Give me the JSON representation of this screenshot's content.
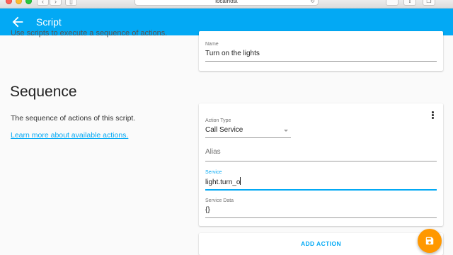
{
  "browser": {
    "url": "localhost",
    "back_glyph": "‹",
    "forward_glyph": "›",
    "reload_glyph": "↻",
    "share_glyph": "⇪",
    "newtab_glyph": "+",
    "tabs_glyph": "❐",
    "sidebar_glyph": "▯"
  },
  "appbar": {
    "title": "Script",
    "color": "#03a9f4"
  },
  "intro": {
    "description": "Use scripts to execute a sequence of actions."
  },
  "name_card": {
    "label": "Name",
    "value": "Turn on the lights"
  },
  "sequence": {
    "title": "Sequence",
    "description": "The sequence of actions of this script.",
    "link_label": "Learn more about available actions."
  },
  "action_card": {
    "action_type": {
      "label": "Action Type",
      "value": "Call Service"
    },
    "alias": {
      "placeholder": "Alias"
    },
    "service": {
      "label": "Service",
      "value": "light.turn_o"
    },
    "service_data": {
      "label": "Service Data",
      "value": "{}"
    },
    "menu_icon": "more-vert-icon"
  },
  "add_action": {
    "label": "ADD ACTION"
  },
  "fab": {
    "icon": "save-icon",
    "color": "#ff9800"
  }
}
